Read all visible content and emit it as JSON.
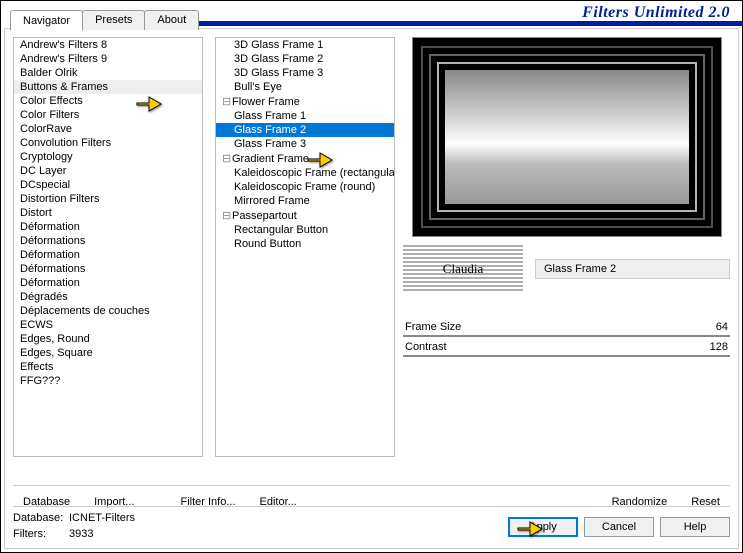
{
  "header": {
    "title": "Filters Unlimited 2.0"
  },
  "tabs": [
    {
      "label": "Navigator",
      "active": true
    },
    {
      "label": "Presets",
      "active": false
    },
    {
      "label": "About",
      "active": false
    }
  ],
  "left_list": [
    "Andrew's Filters 8",
    "Andrew's Filters 9",
    "Balder Olrik",
    "Buttons & Frames",
    "Color Effects",
    "Color Filters",
    "ColorRave",
    "Convolution Filters",
    "Cryptology",
    "DC Layer",
    "DCspecial",
    "Distortion Filters",
    "Distort",
    "Déformation",
    "Déformations",
    "Déformation",
    "Déformations",
    "Déformation",
    "Dégradés",
    "Déplacements de couches",
    "ECWS",
    "Edges, Round",
    "Edges, Square",
    "Effects",
    "FFG???"
  ],
  "left_selected_index": 3,
  "mid_list": [
    {
      "label": "3D Glass Frame 1",
      "indent": true
    },
    {
      "label": "3D Glass Frame 2",
      "indent": true
    },
    {
      "label": "3D Glass Frame 3",
      "indent": true
    },
    {
      "label": "Bull's Eye",
      "indent": true
    },
    {
      "label": "Flower Frame",
      "tree": true
    },
    {
      "label": "Glass Frame 1",
      "indent": true
    },
    {
      "label": "Glass Frame 2",
      "indent": true,
      "highlight": true
    },
    {
      "label": "Glass Frame 3",
      "indent": true
    },
    {
      "label": "Gradient Frame",
      "tree": true
    },
    {
      "label": "Kaleidoscopic Frame (rectangular)",
      "indent": true
    },
    {
      "label": "Kaleidoscopic Frame (round)",
      "indent": true
    },
    {
      "label": "Mirrored Frame",
      "indent": true
    },
    {
      "label": "Passepartout",
      "tree": true
    },
    {
      "label": "Rectangular Button",
      "indent": true
    },
    {
      "label": "Round Button",
      "indent": true
    }
  ],
  "right": {
    "current_filter": "Glass Frame 2",
    "sliders": [
      {
        "label": "Frame Size",
        "value": 64
      },
      {
        "label": "Contrast",
        "value": 128
      }
    ]
  },
  "buttons_row": {
    "database": "Database",
    "import": "Import...",
    "filter_info": "Filter Info...",
    "editor": "Editor...",
    "randomize": "Randomize",
    "reset": "Reset"
  },
  "status": {
    "db_label": "Database:",
    "db_value": "ICNET-Filters",
    "filters_label": "Filters:",
    "filters_value": "3933"
  },
  "action_buttons": {
    "apply": "Apply",
    "cancel": "Cancel",
    "help": "Help"
  }
}
